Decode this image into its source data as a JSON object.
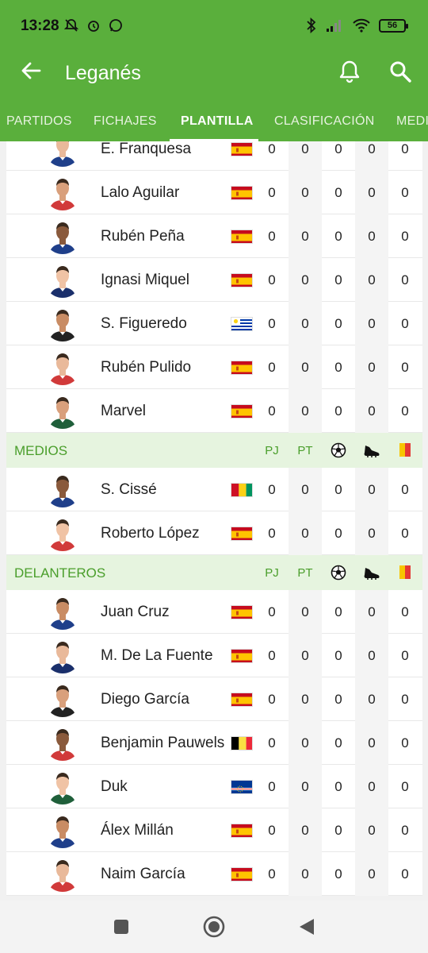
{
  "status": {
    "time": "13:28",
    "battery": "56"
  },
  "header": {
    "title": "Leganés"
  },
  "tabs": [
    {
      "label": "PARTIDOS"
    },
    {
      "label": "FICHAJES"
    },
    {
      "label": "PLANTILLA"
    },
    {
      "label": "CLASIFICACIÓN"
    },
    {
      "label": "MEDI"
    }
  ],
  "columns": [
    "PJ",
    "PT",
    "goal-icon",
    "assist-boot-icon",
    "card-icon"
  ],
  "defenders_tail": [
    {
      "name": "E. Franquesa",
      "flag": "spain",
      "stats": [
        "0",
        "0",
        "0",
        "0",
        "0"
      ]
    },
    {
      "name": "Lalo Aguilar",
      "flag": "spain",
      "stats": [
        "0",
        "0",
        "0",
        "0",
        "0"
      ]
    },
    {
      "name": "Rubén Peña",
      "flag": "spain",
      "stats": [
        "0",
        "0",
        "0",
        "0",
        "0"
      ]
    },
    {
      "name": "Ignasi Miquel",
      "flag": "spain",
      "stats": [
        "0",
        "0",
        "0",
        "0",
        "0"
      ]
    },
    {
      "name": "S. Figueredo",
      "flag": "uruguay",
      "stats": [
        "0",
        "0",
        "0",
        "0",
        "0"
      ]
    },
    {
      "name": "Rubén Pulido",
      "flag": "spain",
      "stats": [
        "0",
        "0",
        "0",
        "0",
        "0"
      ]
    },
    {
      "name": "Marvel",
      "flag": "spain",
      "stats": [
        "0",
        "0",
        "0",
        "0",
        "0"
      ]
    }
  ],
  "midfielders": {
    "title": "MEDIOS",
    "headers": {
      "pj": "PJ",
      "pt": "PT"
    },
    "players": [
      {
        "name": "S. Cissé",
        "flag": "guinea",
        "stats": [
          "0",
          "0",
          "0",
          "0",
          "0"
        ]
      },
      {
        "name": "Roberto López",
        "flag": "spain",
        "stats": [
          "0",
          "0",
          "0",
          "0",
          "0"
        ]
      }
    ]
  },
  "forwards": {
    "title": "DELANTEROS",
    "headers": {
      "pj": "PJ",
      "pt": "PT"
    },
    "players": [
      {
        "name": "Juan Cruz",
        "flag": "spain",
        "stats": [
          "0",
          "0",
          "0",
          "0",
          "0"
        ]
      },
      {
        "name": "M. De La Fuente",
        "flag": "spain",
        "stats": [
          "0",
          "0",
          "0",
          "0",
          "0"
        ]
      },
      {
        "name": "Diego García",
        "flag": "spain",
        "stats": [
          "0",
          "0",
          "0",
          "0",
          "0"
        ]
      },
      {
        "name": "Benjamin Pauwels",
        "flag": "belgium",
        "stats": [
          "0",
          "0",
          "0",
          "0",
          "0"
        ]
      },
      {
        "name": "Duk",
        "flag": "cape-verde",
        "stats": [
          "0",
          "0",
          "0",
          "0",
          "0"
        ]
      },
      {
        "name": "Álex Millán",
        "flag": "spain",
        "stats": [
          "0",
          "0",
          "0",
          "0",
          "0"
        ]
      },
      {
        "name": "Naim García",
        "flag": "spain",
        "stats": [
          "0",
          "0",
          "0",
          "0",
          "0"
        ]
      }
    ]
  },
  "colors": {
    "primary": "#5aaf3c",
    "section_bg": "#e6f4df",
    "section_text": "#4a9e2b"
  }
}
